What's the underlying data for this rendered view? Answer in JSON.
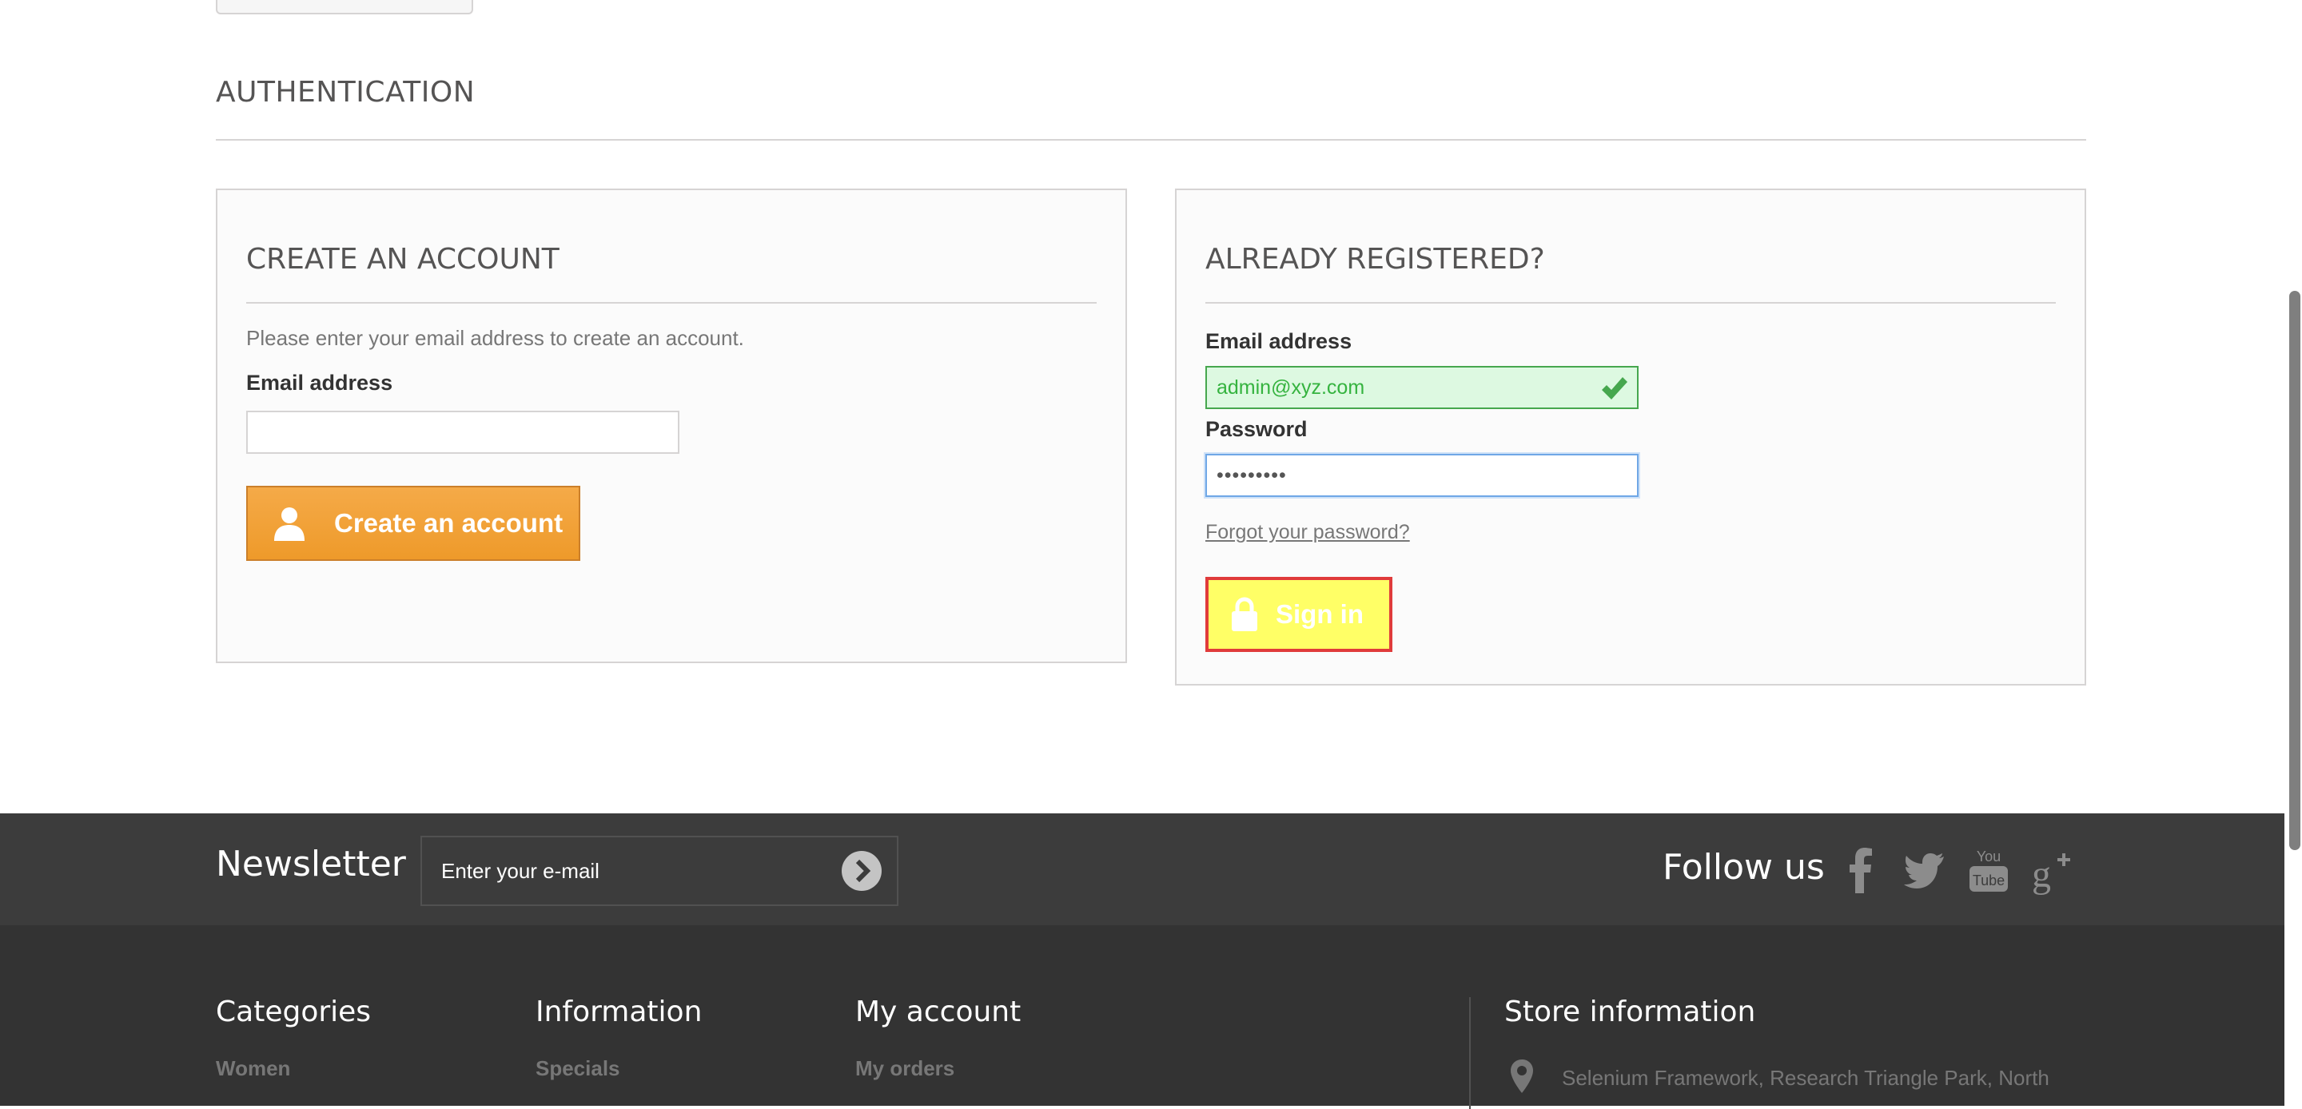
{
  "page": {
    "heading": "AUTHENTICATION"
  },
  "create_account": {
    "title": "CREATE AN ACCOUNT",
    "instruction": "Please enter your email address to create an account.",
    "email_label": "Email address",
    "email_value": "",
    "button_label": "Create an account",
    "button_icon": "user-icon"
  },
  "login": {
    "title": "ALREADY REGISTERED?",
    "email_label": "Email address",
    "email_value": "admin@xyz.com",
    "email_status_icon": "checkmark-icon",
    "password_label": "Password",
    "password_value": "•••••••••",
    "forgot_link": "Forgot your password?",
    "signin_label": "Sign in",
    "signin_icon": "lock-icon",
    "signin_highlight": {
      "background": "#ffff66",
      "border": "#e03b3b"
    }
  },
  "newsletter": {
    "title": "Newsletter",
    "placeholder": "Enter your e-mail",
    "submit_icon": "arrow-right-circle-icon"
  },
  "social": {
    "title": "Follow us",
    "icons": [
      "facebook-icon",
      "twitter-icon",
      "youtube-icon",
      "google-plus-icon"
    ]
  },
  "footer": {
    "categories": {
      "title": "Categories",
      "links": [
        "Women"
      ]
    },
    "information": {
      "title": "Information",
      "links": [
        "Specials"
      ]
    },
    "my_account": {
      "title": "My account",
      "links": [
        "My orders"
      ]
    },
    "store": {
      "title": "Store information",
      "address": "Selenium Framework, Research Triangle Park, North",
      "icon": "map-pin-icon"
    }
  },
  "colors": {
    "accent_orange": "#f0a03a",
    "valid_green": "#46a74e",
    "newsletter_bg": "#3c3c3c",
    "footer_bg": "#333333"
  }
}
